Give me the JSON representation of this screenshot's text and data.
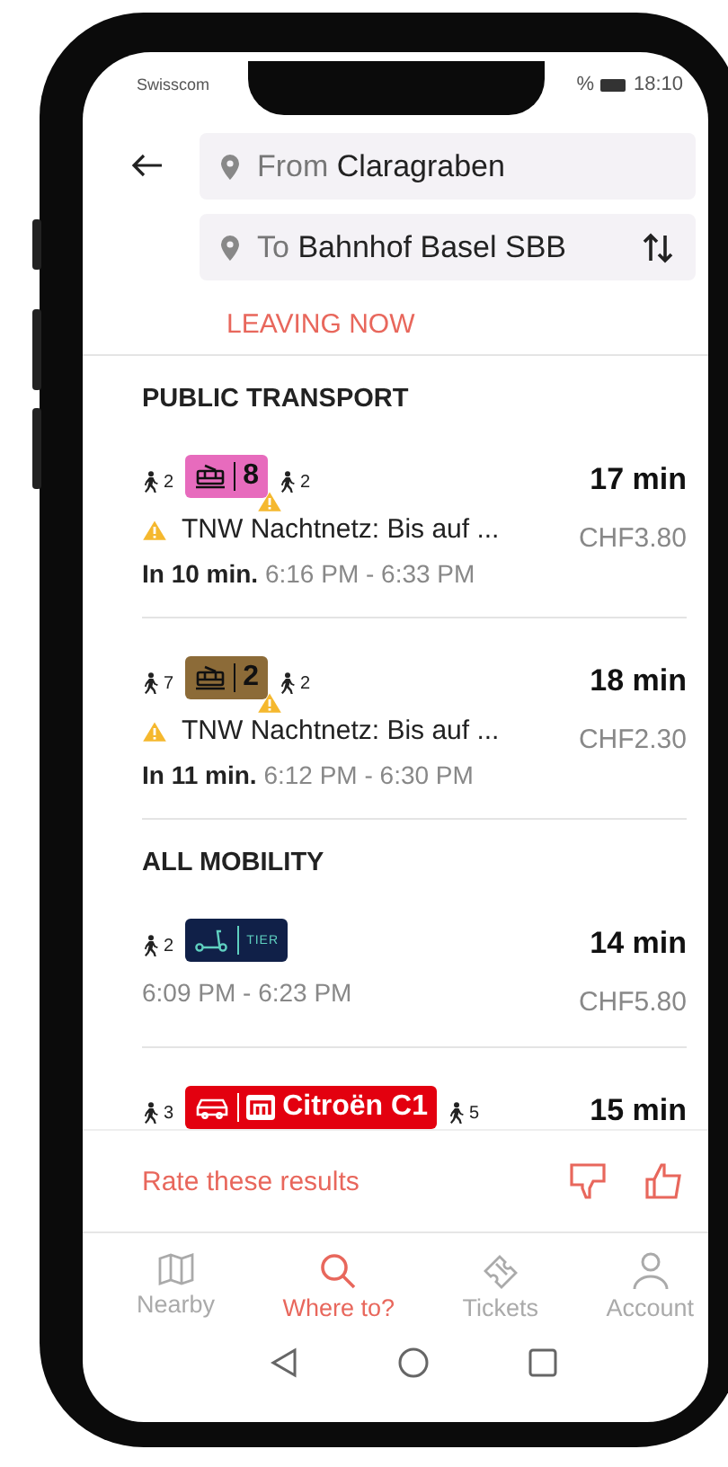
{
  "status_bar": {
    "carrier": "Swisscom",
    "battery": "%",
    "time": "18:10"
  },
  "search": {
    "from": {
      "prefix": "From",
      "value": "Claragraben"
    },
    "to": {
      "prefix": "To",
      "value": "Bahnhof Basel SBB"
    }
  },
  "departure": "LEAVING NOW",
  "sections": [
    {
      "title": "PUBLIC TRANSPORT",
      "results": [
        {
          "legs": [
            {
              "kind": "walk",
              "minutes": "2"
            },
            {
              "kind": "tram",
              "label": "8",
              "color": "#e76bbd",
              "warning": true
            },
            {
              "kind": "walk",
              "minutes": "2"
            }
          ],
          "notice": "TNW Nachtnetz: Bis auf ...",
          "departs": "In 10 min.",
          "times": "6:16 PM - 6:33 PM",
          "duration": "17 min",
          "price": "CHF3.80"
        },
        {
          "legs": [
            {
              "kind": "walk",
              "minutes": "7"
            },
            {
              "kind": "tram",
              "label": "2",
              "color": "#8c6b38",
              "warning": true
            },
            {
              "kind": "walk",
              "minutes": "2"
            }
          ],
          "notice": "TNW Nachtnetz: Bis auf ...",
          "departs": "In 11 min.",
          "times": "6:12 PM - 6:30 PM",
          "duration": "18 min",
          "price": "CHF2.30"
        }
      ]
    },
    {
      "title": "ALL MOBILITY",
      "results": [
        {
          "legs": [
            {
              "kind": "walk",
              "minutes": "2"
            },
            {
              "kind": "scooter",
              "label": "TIER",
              "color": "#102048",
              "warning": false
            }
          ],
          "times": "6:09 PM - 6:23 PM",
          "duration": "14 min",
          "price": "CHF5.80"
        },
        {
          "legs": [
            {
              "kind": "walk",
              "minutes": "3"
            },
            {
              "kind": "car",
              "label": "Citroën C1",
              "color": "#e3000f",
              "warning": false
            },
            {
              "kind": "walk",
              "minutes": "5"
            }
          ],
          "duration": "15 min"
        }
      ]
    }
  ],
  "rating": {
    "label": "Rate these results"
  },
  "tabs": [
    {
      "label": "Nearby",
      "selected": false
    },
    {
      "label": "Where to?",
      "selected": true
    },
    {
      "label": "Tickets",
      "selected": false
    },
    {
      "label": "Account",
      "selected": false
    }
  ]
}
